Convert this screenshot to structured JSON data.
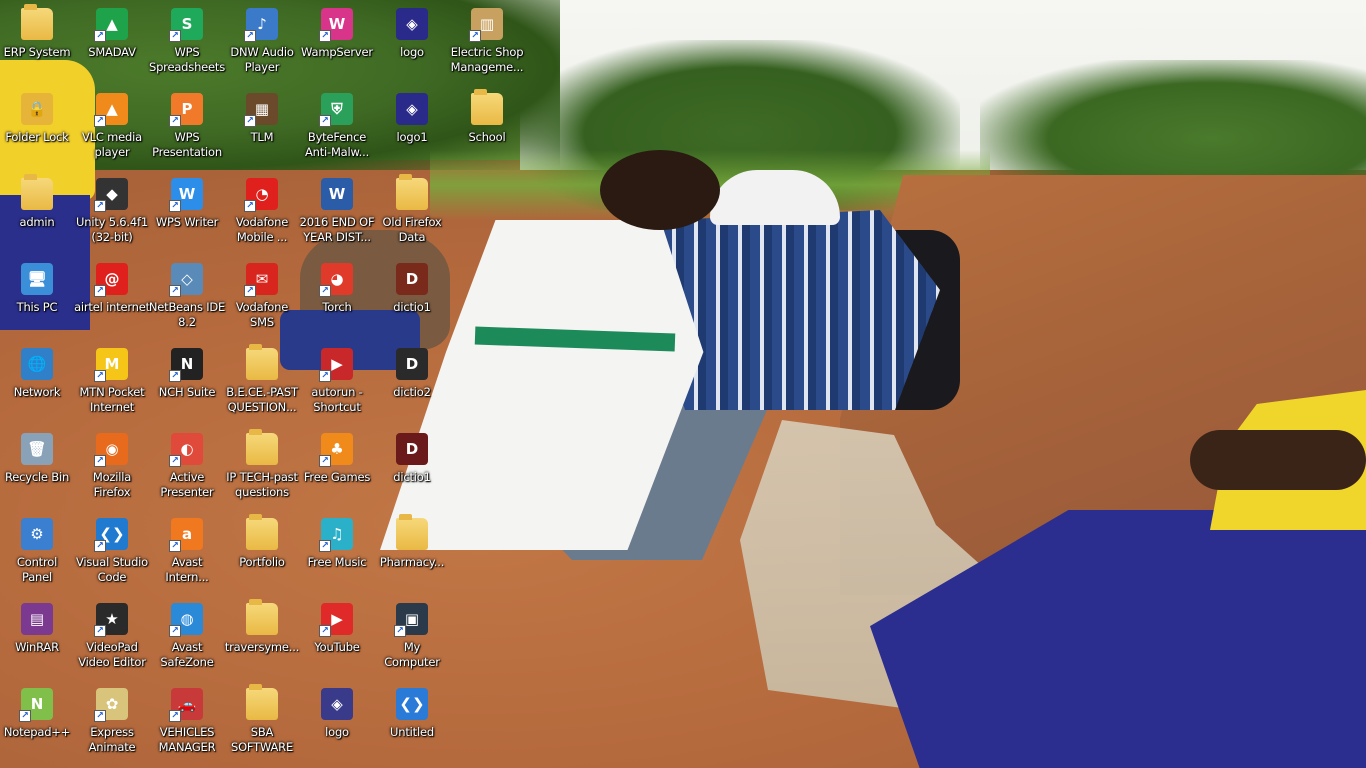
{
  "desktop": {
    "columns": [
      [
        {
          "label": "ERP System",
          "icon": "folder-icon",
          "kind": "folder",
          "shortcut": false
        },
        {
          "label": "Folder Lock",
          "icon": "folder-lock-icon",
          "kind": "app",
          "color": "#e7b43a",
          "glyph": "🔒",
          "shortcut": false
        },
        {
          "label": "admin",
          "icon": "user-folder-icon",
          "kind": "folder",
          "shortcut": false
        },
        {
          "label": "This PC",
          "icon": "computer-icon",
          "kind": "app",
          "color": "#3a8fd8",
          "glyph": "🖥",
          "shortcut": false
        },
        {
          "label": "Network",
          "icon": "network-icon",
          "kind": "app",
          "color": "#2f7fc9",
          "glyph": "🌐",
          "shortcut": false
        },
        {
          "label": "Recycle Bin",
          "icon": "recycle-bin-icon",
          "kind": "app",
          "color": "#8aa2b8",
          "glyph": "🗑",
          "shortcut": false
        },
        {
          "label": "Control\nPanel",
          "icon": "control-panel-icon",
          "kind": "app",
          "color": "#3b7fd0",
          "glyph": "⚙",
          "shortcut": false
        },
        {
          "label": "WinRAR",
          "icon": "winrar-icon",
          "kind": "app",
          "color": "#7b3a8f",
          "glyph": "▤",
          "shortcut": false
        },
        {
          "label": "Notepad++",
          "icon": "notepad-plus-plus-icon",
          "kind": "app",
          "color": "#7fbf4a",
          "glyph": "N",
          "shortcut": true
        }
      ],
      [
        {
          "label": "SMADAV",
          "icon": "smadav-icon",
          "kind": "app",
          "color": "#1fa34a",
          "glyph": "▲",
          "shortcut": true
        },
        {
          "label": "VLC media\nplayer",
          "icon": "vlc-icon",
          "kind": "app",
          "color": "#f08a1a",
          "glyph": "▲",
          "shortcut": true
        },
        {
          "label": "Unity 5.6.4f1\n(32-bit)",
          "icon": "unity-icon",
          "kind": "app",
          "color": "#333333",
          "glyph": "◆",
          "shortcut": true
        },
        {
          "label": "airtel internet",
          "icon": "airtel-icon",
          "kind": "app",
          "color": "#e0201c",
          "glyph": "@",
          "shortcut": true
        },
        {
          "label": "MTN Pocket\nInternet",
          "icon": "mtn-icon",
          "kind": "app",
          "color": "#f5c518",
          "glyph": "M",
          "shortcut": true
        },
        {
          "label": "Mozilla\nFirefox",
          "icon": "firefox-icon",
          "kind": "app",
          "color": "#e86a1c",
          "glyph": "◉",
          "shortcut": true
        },
        {
          "label": "Visual Studio\nCode",
          "icon": "vscode-icon",
          "kind": "app",
          "color": "#1f7ad0",
          "glyph": "❮❯",
          "shortcut": true
        },
        {
          "label": "VideoPad\nVideo Editor",
          "icon": "videopad-icon",
          "kind": "app",
          "color": "#2a2a2a",
          "glyph": "★",
          "shortcut": true
        },
        {
          "label": "Express\nAnimate",
          "icon": "express-animate-icon",
          "kind": "app",
          "color": "#d8c47a",
          "glyph": "✿",
          "shortcut": true
        }
      ],
      [
        {
          "label": "WPS\nSpreadsheets",
          "icon": "wps-spreadsheets-icon",
          "kind": "app",
          "color": "#1eaa5a",
          "glyph": "S",
          "shortcut": true
        },
        {
          "label": "WPS\nPresentation",
          "icon": "wps-presentation-icon",
          "kind": "app",
          "color": "#f07a2a",
          "glyph": "P",
          "shortcut": true
        },
        {
          "label": "WPS Writer",
          "icon": "wps-writer-icon",
          "kind": "app",
          "color": "#2c8ee8",
          "glyph": "W",
          "shortcut": true
        },
        {
          "label": "NetBeans IDE\n8.2",
          "icon": "netbeans-icon",
          "kind": "app",
          "color": "#5a8ab8",
          "glyph": "◇",
          "shortcut": true
        },
        {
          "label": "NCH Suite",
          "icon": "nch-suite-icon",
          "kind": "app",
          "color": "#222222",
          "glyph": "N",
          "shortcut": true
        },
        {
          "label": "Active\nPresenter",
          "icon": "active-presenter-icon",
          "kind": "app",
          "color": "#e04a3a",
          "glyph": "◐",
          "shortcut": true
        },
        {
          "label": "Avast\nIntern...",
          "icon": "avast-icon",
          "kind": "app",
          "color": "#f0781e",
          "glyph": "a",
          "shortcut": true
        },
        {
          "label": "Avast\nSafeZone",
          "icon": "avast-safezone-icon",
          "kind": "app",
          "color": "#2a8ad8",
          "glyph": "◍",
          "shortcut": true
        },
        {
          "label": "VEHICLES\nMANAGER",
          "icon": "vehicles-manager-icon",
          "kind": "app",
          "color": "#c83a3a",
          "glyph": "🚗",
          "shortcut": true
        }
      ],
      [
        {
          "label": "DNW Audio\nPlayer",
          "icon": "dnw-audio-player-icon",
          "kind": "app",
          "color": "#3a7ac8",
          "glyph": "♪",
          "shortcut": true
        },
        {
          "label": "TLM",
          "icon": "tlm-icon",
          "kind": "app",
          "color": "#6a4a2a",
          "glyph": "▦",
          "shortcut": true
        },
        {
          "label": "Vodafone\nMobile ...",
          "icon": "vodafone-icon",
          "kind": "app",
          "color": "#e0201c",
          "glyph": "◔",
          "shortcut": true
        },
        {
          "label": "Vodafone\nSMS",
          "icon": "vodafone-sms-icon",
          "kind": "app",
          "color": "#d8261e",
          "glyph": "✉",
          "shortcut": true
        },
        {
          "label": "B.E.CE.-PAST\nQUESTION...",
          "icon": "folder-icon",
          "kind": "folder",
          "shortcut": false
        },
        {
          "label": "IP TECH-past\nquestions",
          "icon": "folder-icon",
          "kind": "folder",
          "shortcut": false
        },
        {
          "label": "Portfolio",
          "icon": "folder-icon",
          "kind": "folder",
          "shortcut": false
        },
        {
          "label": "traversyme...",
          "icon": "folder-icon",
          "kind": "folder",
          "shortcut": false
        },
        {
          "label": "SBA\nSOFTWARE",
          "icon": "folder-icon",
          "kind": "folder",
          "shortcut": false
        }
      ],
      [
        {
          "label": "WampServer",
          "icon": "wampserver-icon",
          "kind": "app",
          "color": "#d8348a",
          "glyph": "W",
          "shortcut": true
        },
        {
          "label": "ByteFence\nAnti-Malw...",
          "icon": "bytefence-icon",
          "kind": "app",
          "color": "#2aa05a",
          "glyph": "⛨",
          "shortcut": true
        },
        {
          "label": "2016 END OF\nYEAR DIST...",
          "icon": "word-document-icon",
          "kind": "app",
          "color": "#2b5ca8",
          "glyph": "W",
          "shortcut": false
        },
        {
          "label": "Torch",
          "icon": "torch-browser-icon",
          "kind": "app",
          "color": "#e03a2a",
          "glyph": "◕",
          "shortcut": true
        },
        {
          "label": "autorun -\nShortcut",
          "icon": "autorun-icon",
          "kind": "app",
          "color": "#c8282a",
          "glyph": "▶",
          "shortcut": true
        },
        {
          "label": "Free Games",
          "icon": "free-games-icon",
          "kind": "app",
          "color": "#f08a1a",
          "glyph": "♣",
          "shortcut": true
        },
        {
          "label": "Free Music",
          "icon": "free-music-icon",
          "kind": "app",
          "color": "#2ab0c8",
          "glyph": "♫",
          "shortcut": true
        },
        {
          "label": "YouTube",
          "icon": "youtube-icon",
          "kind": "app",
          "color": "#e02a2a",
          "glyph": "▶",
          "shortcut": true
        },
        {
          "label": "logo",
          "icon": "image-logo-icon",
          "kind": "app",
          "color": "#3a3a8a",
          "glyph": "◈",
          "shortcut": false
        }
      ],
      [
        {
          "label": "logo",
          "icon": "image-logo-icon",
          "kind": "app",
          "color": "#2a2a8a",
          "glyph": "◈",
          "shortcut": false
        },
        {
          "label": "logo1",
          "icon": "image-logo-icon",
          "kind": "app",
          "color": "#2a2a8a",
          "glyph": "◈",
          "shortcut": false
        },
        {
          "label": "Old Firefox\nData",
          "icon": "folder-icon",
          "kind": "folder",
          "shortcut": false
        },
        {
          "label": "dictio1",
          "icon": "dictionary-icon",
          "kind": "app",
          "color": "#7a2a1a",
          "glyph": "D",
          "shortcut": false
        },
        {
          "label": "dictio2",
          "icon": "dictionary-icon",
          "kind": "app",
          "color": "#2a2a2a",
          "glyph": "D",
          "shortcut": false
        },
        {
          "label": "dictio1",
          "icon": "dictionary-icon",
          "kind": "app",
          "color": "#6a1a1a",
          "glyph": "D",
          "shortcut": false
        },
        {
          "label": "Pharmacy...",
          "icon": "folder-icon",
          "kind": "folder",
          "shortcut": false
        },
        {
          "label": "My\nComputer",
          "icon": "my-computer-icon",
          "kind": "app",
          "color": "#2a3a4a",
          "glyph": "▣",
          "shortcut": true
        },
        {
          "label": "Untitled",
          "icon": "vscode-file-icon",
          "kind": "app",
          "color": "#2a7ad8",
          "glyph": "❮❯",
          "shortcut": false
        }
      ],
      [
        {
          "label": "Electric Shop\nManageme...",
          "icon": "package-icon",
          "kind": "app",
          "color": "#c8a060",
          "glyph": "▥",
          "shortcut": true
        },
        {
          "label": "School",
          "icon": "folder-icon",
          "kind": "folder",
          "shortcut": false
        }
      ]
    ]
  }
}
